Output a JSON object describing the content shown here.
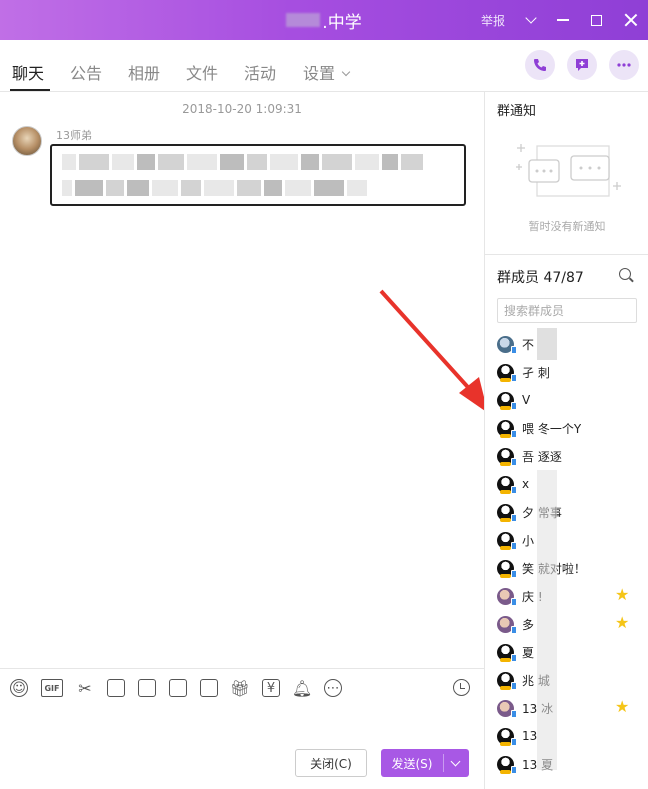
{
  "window": {
    "title_suffix": ".中学",
    "report_label": "举报",
    "accent": "#a64ee0"
  },
  "tabs": [
    {
      "label": "聊天",
      "active": true
    },
    {
      "label": "公告"
    },
    {
      "label": "相册"
    },
    {
      "label": "文件"
    },
    {
      "label": "活动"
    },
    {
      "label": "设置"
    }
  ],
  "header_actions": [
    "phone-icon",
    "add-chat-icon",
    "more-icon"
  ],
  "chat": {
    "timestamp": "2018-10-20 1:09:31",
    "messages": [
      {
        "sender": "13师弟",
        "content_pixelated": true
      }
    ]
  },
  "composer": {
    "tools": [
      "emoji-icon",
      "gif-icon",
      "scissors-icon",
      "folder-icon",
      "shake-icon",
      "image-icon",
      "photo-booth-icon",
      "gift-icon",
      "red-packet-icon",
      "bell-icon",
      "more-tools-icon"
    ],
    "gif_label": "GIF",
    "close_label": "关闭(C)",
    "send_label": "发送(S)"
  },
  "sidebar": {
    "notice_title": "群通知",
    "notice_empty": "暂时没有新通知",
    "members_title": "群成员 47/87",
    "search_placeholder": "搜索群成员",
    "members": [
      {
        "name": "不",
        "avatar": "photo2",
        "star": false
      },
      {
        "name": "孑   刺",
        "avatar": "qq",
        "star": false
      },
      {
        "name": "V",
        "avatar": "qq",
        "star": false
      },
      {
        "name": "喂   冬一个Y",
        "avatar": "qq",
        "star": false
      },
      {
        "name": "吾   逐逐",
        "avatar": "qq",
        "star": false
      },
      {
        "name": "x",
        "avatar": "qq",
        "star": false
      },
      {
        "name": "夕   常事",
        "avatar": "qq",
        "star": false
      },
      {
        "name": "小",
        "avatar": "qq",
        "star": false
      },
      {
        "name": "笑   就对啦！",
        "avatar": "qq",
        "star": false
      },
      {
        "name": "庆   !",
        "avatar": "photo",
        "star": true
      },
      {
        "name": "多",
        "avatar": "photo",
        "star": true
      },
      {
        "name": "   夏",
        "avatar": "qq",
        "star": false
      },
      {
        "name": "兆   城",
        "avatar": "qq",
        "star": false
      },
      {
        "name": "13   冰",
        "avatar": "photo",
        "star": true
      },
      {
        "name": "13",
        "avatar": "qq",
        "star": false
      },
      {
        "name": "13   夏",
        "avatar": "qq",
        "star": false
      }
    ]
  }
}
